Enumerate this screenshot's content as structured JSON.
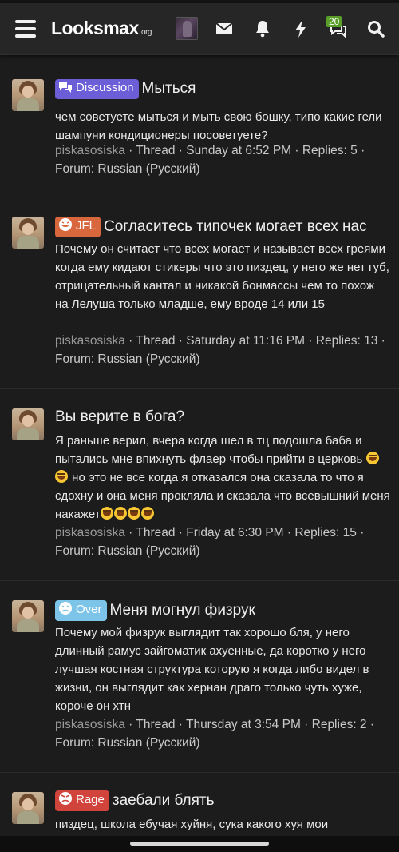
{
  "header": {
    "logo_text": "Looksmax",
    "logo_suffix": ".org",
    "notifications_count": "20",
    "icons": [
      "menu-icon",
      "user-avatar",
      "envelope-icon",
      "bell-icon",
      "bolt-icon",
      "chat-bubbles-icon",
      "search-icon"
    ]
  },
  "colors": {
    "background": "#1c1c1c",
    "header": "#262626",
    "discussion": "#6b5ed6",
    "jfl": "#d9673e",
    "over": "#7cc4e8",
    "rage": "#d0443c",
    "count_badge": "#5a9e2a"
  },
  "threads": [
    {
      "prefix": "Discussion",
      "prefix_icon": "chat-icon",
      "title": "Мыться",
      "snippet": "чем советуете мыться и мыть свою бошку, типо какие гели шампуни кондиционеры посоветуете?",
      "author": "piskasosiska",
      "meta": " · Thread · Sunday at 6:52 PM · Replies: 5 · Forum: Russian (Русский)"
    },
    {
      "prefix": "JFL",
      "prefix_icon": "laugh-icon",
      "title": "Согласитесь типочек могает всех нас",
      "snippet": "Почему он считает что всех могает и называет всех греями когда ему кидают стикеры что это пиздец, у него же нет губ, отрицательный кантал и никакой бонмассы чем то похож на Лелуша только младше, ему вроде 14 или 15",
      "author": "piskasosiska",
      "meta": " · Thread · Saturday at 11:16 PM · Replies: 13 · Forum: Russian (Русский)"
    },
    {
      "prefix": "",
      "prefix_icon": "",
      "title": "Вы верите в бога?",
      "snippet_parts": [
        "Я раньше верил, вчера когда шел в тц подошла баба и пытались мне впихнуть флаер чтобы прийти в церковь ",
        " но это не все когда я отказался она сказала то что я сдохну и она меня прокляла и сказала что всевышний меня накажет"
      ],
      "author": "piskasosiska",
      "meta": " · Thread · Friday at 6:30 PM · Replies: 15 · Forum: Russian (Русский)"
    },
    {
      "prefix": "Over",
      "prefix_icon": "sad-face-icon",
      "title": "Меня могнул физрук",
      "snippet": "Почему мой физрук выглядит так хорошо бля, у него длинный рамус зайгоматик ахуенные, да коротко у него лучшая костная структура которую я когда либо видел в жизни, он выглядит как хернан драго только чуть хуже, короче он хтн",
      "author": "piskasosiska",
      "meta": " · Thread · Thursday at 3:54 PM · Replies: 2 · Forum: Russian (Русский)"
    },
    {
      "prefix": "Rage",
      "prefix_icon": "angry-face-icon",
      "title": "заебали блять",
      "snippet": "пиздец, школа ебучая хуйня, сука какого хуя мои"
    }
  ]
}
